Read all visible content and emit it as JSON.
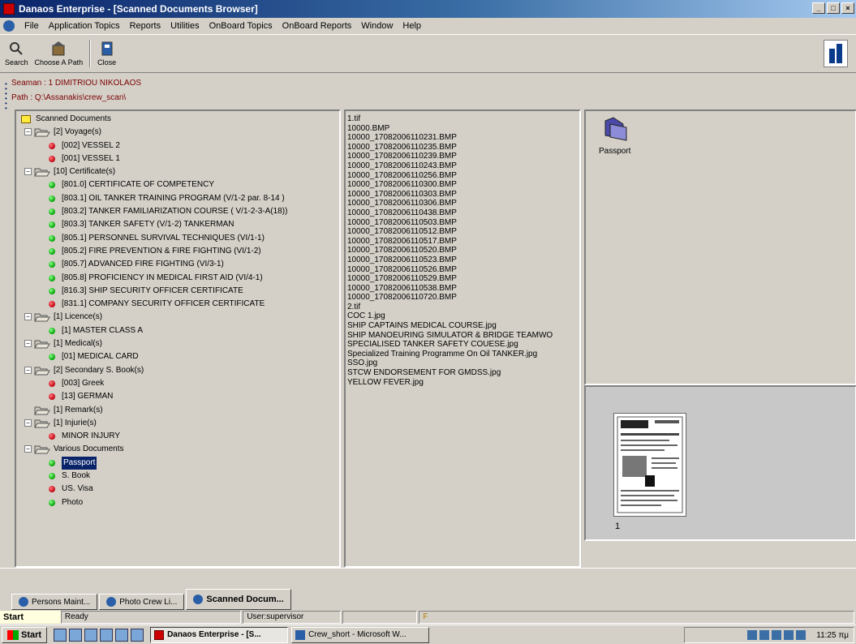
{
  "window": {
    "title": "Danaos Enterprise - [Scanned Documents Browser]"
  },
  "menu": [
    "File",
    "Application Topics",
    "Reports",
    "Utilities",
    "OnBoard Topics",
    "OnBoard Reports",
    "Window",
    "Help"
  ],
  "toolbar": {
    "search": "Search",
    "choose_path": "Choose A Path",
    "close": "Close"
  },
  "info": {
    "seaman": "Seaman : 1 DIMITRIOU NIKOLAOS",
    "path": "Path : Q:\\Assanakis\\crew_scan\\"
  },
  "tree": [
    {
      "depth": 0,
      "kind": "root",
      "label": "Scanned Documents"
    },
    {
      "depth": 1,
      "kind": "folder",
      "label": "[2] Voyage(s)"
    },
    {
      "depth": 2,
      "kind": "red",
      "label": "[002] VESSEL 2"
    },
    {
      "depth": 2,
      "kind": "red",
      "label": "[001] VESSEL 1"
    },
    {
      "depth": 1,
      "kind": "folder",
      "label": "[10] Certificate(s)"
    },
    {
      "depth": 2,
      "kind": "green",
      "label": "[801.0] CERTIFICATE OF COMPETENCY"
    },
    {
      "depth": 2,
      "kind": "green",
      "label": "[803.1] OIL TANKER TRAINING PROGRAM (V/1-2 par. 8-14 )"
    },
    {
      "depth": 2,
      "kind": "green",
      "label": "[803.2] TANKER FAMILIARIZATION COURSE ( V/1-2-3-A(18))"
    },
    {
      "depth": 2,
      "kind": "green",
      "label": "[803.3] TANKER SAFETY (V/1-2) TANKERMAN"
    },
    {
      "depth": 2,
      "kind": "green",
      "label": "[805.1] PERSONNEL SURVIVAL TECHNIQUES (VI/1-1)"
    },
    {
      "depth": 2,
      "kind": "green",
      "label": "[805.2] FIRE PREVENTION & FIRE FIGHTING (VI/1-2)"
    },
    {
      "depth": 2,
      "kind": "green",
      "label": "[805.7] ADVANCED FIRE FIGHTING (VI/3-1)"
    },
    {
      "depth": 2,
      "kind": "green",
      "label": "[805.8] PROFICIENCY IN MEDICAL FIRST AID (VI/4-1)"
    },
    {
      "depth": 2,
      "kind": "green",
      "label": "[816.3] SHIP SECURITY OFFICER CERTIFICATE"
    },
    {
      "depth": 2,
      "kind": "red",
      "label": "[831.1] COMPANY SECURITY OFFICER CERTIFICATE"
    },
    {
      "depth": 1,
      "kind": "folder",
      "label": "[1] Licence(s)"
    },
    {
      "depth": 2,
      "kind": "green",
      "label": "[1] MASTER CLASS A"
    },
    {
      "depth": 1,
      "kind": "folder",
      "label": "[1] Medical(s)"
    },
    {
      "depth": 2,
      "kind": "green",
      "label": "[01] MEDICAL CARD"
    },
    {
      "depth": 1,
      "kind": "folder",
      "label": "[2] Secondary S. Book(s)"
    },
    {
      "depth": 2,
      "kind": "red",
      "label": "[003] Greek"
    },
    {
      "depth": 2,
      "kind": "red",
      "label": "[13] GERMAN"
    },
    {
      "depth": 1,
      "kind": "folder-noexp",
      "label": "[1] Remark(s)"
    },
    {
      "depth": 1,
      "kind": "folder",
      "label": "[1] Injurie(s)"
    },
    {
      "depth": 2,
      "kind": "red",
      "label": "MINOR INJURY"
    },
    {
      "depth": 1,
      "kind": "folder",
      "label": "Various Documents"
    },
    {
      "depth": 2,
      "kind": "green",
      "label": "Passport",
      "selected": true
    },
    {
      "depth": 2,
      "kind": "green",
      "label": "S. Book"
    },
    {
      "depth": 2,
      "kind": "red",
      "label": "US. Visa"
    },
    {
      "depth": 2,
      "kind": "green",
      "label": "Photo"
    }
  ],
  "files": [
    "1.tif",
    "10000.BMP",
    "10000_17082006110231.BMP",
    "10000_17082006110235.BMP",
    "10000_17082006110239.BMP",
    "10000_17082006110243.BMP",
    "10000_17082006110256.BMP",
    "10000_17082006110300.BMP",
    "10000_17082006110303.BMP",
    "10000_17082006110306.BMP",
    "10000_17082006110438.BMP",
    "10000_17082006110503.BMP",
    "10000_17082006110512.BMP",
    "10000_17082006110517.BMP",
    "10000_17082006110520.BMP",
    "10000_17082006110523.BMP",
    "10000_17082006110526.BMP",
    "10000_17082006110529.BMP",
    "10000_17082006110538.BMP",
    "10000_17082006110720.BMP",
    "2.tif",
    "COC 1.jpg",
    "SHIP CAPTAINS MEDICAL COURSE.jpg",
    "SHIP MANOEURING SIMULATOR & BRIDGE TEAMWO",
    "SPECIALISED TANKER SAFETY COUESE.jpg",
    "Specialized Training Programme On Oil TANKER.jpg",
    "SSO.jpg",
    "STCW ENDORSEMENT FOR GMDSS.jpg",
    "YELLOW FEVER.jpg"
  ],
  "preview": {
    "folder_label": "Passport",
    "thumb_label": "1"
  },
  "doc_tabs": [
    {
      "label": "Persons Maint...",
      "active": false
    },
    {
      "label": "Photo Crew Li...",
      "active": false
    },
    {
      "label": "Scanned Docum...",
      "active": true
    }
  ],
  "status": {
    "start": "Start",
    "ready": "Ready",
    "user": "User:supervisor",
    "flag": "F"
  },
  "taskbar": {
    "start": "Start",
    "tasks": [
      {
        "label": "Danaos Enterprise - [S...",
        "active": true
      },
      {
        "label": "Crew_short - Microsoft W...",
        "active": false
      }
    ],
    "clock": "11:25 πμ"
  }
}
